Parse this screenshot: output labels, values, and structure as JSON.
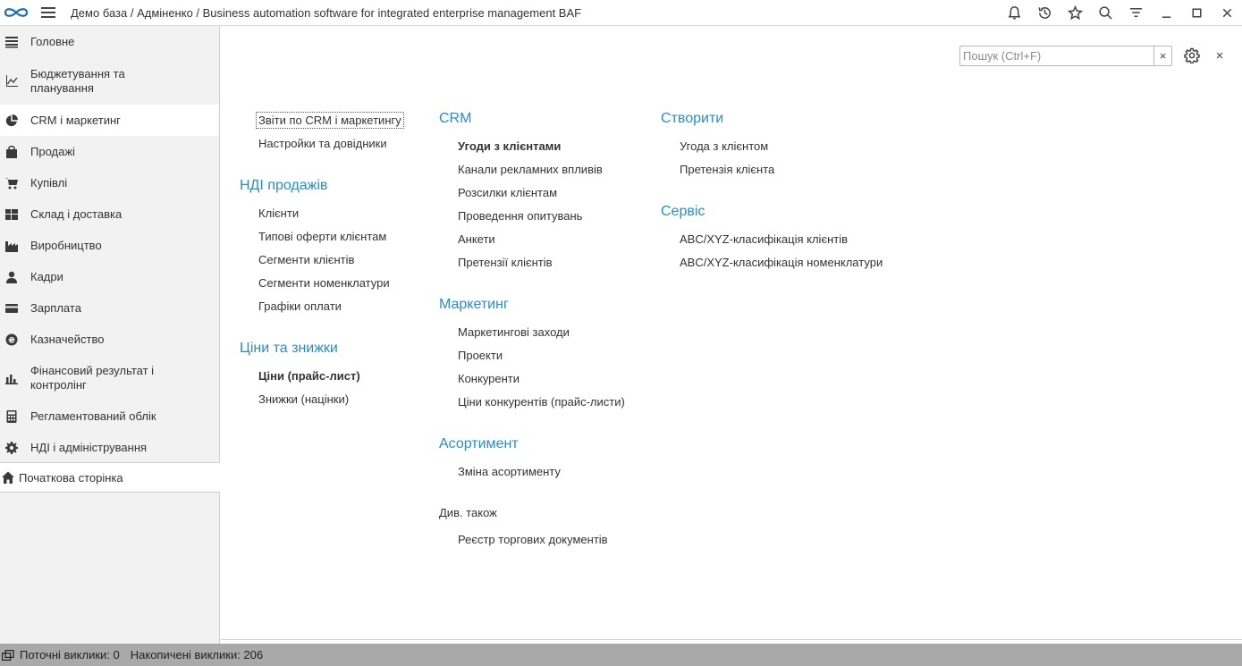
{
  "window": {
    "title": "Демо база / Адміненко / Business automation software for integrated enterprise management BAF"
  },
  "toolbar_icons": [
    "bell-icon",
    "history-icon",
    "star-icon",
    "search-icon",
    "filter-icon",
    "minimize-icon",
    "maximize-icon",
    "close-icon"
  ],
  "sidebar": {
    "items": [
      {
        "label": "Головне",
        "icon": "list-icon"
      },
      {
        "label": "Бюджетування та планування",
        "icon": "chart-line-icon"
      },
      {
        "label": "CRM і маркетинг",
        "icon": "pie-chart-icon"
      },
      {
        "label": "Продажі",
        "icon": "bag-icon"
      },
      {
        "label": "Купівлі",
        "icon": "cart-icon"
      },
      {
        "label": "Склад і доставка",
        "icon": "grid-icon"
      },
      {
        "label": "Виробництво",
        "icon": "factory-icon"
      },
      {
        "label": "Кадри",
        "icon": "person-icon"
      },
      {
        "label": "Зарплата",
        "icon": "card-icon"
      },
      {
        "label": "Казначейство",
        "icon": "coin-icon"
      },
      {
        "label": "Фінансовий результат і контролінг",
        "icon": "bar-chart-icon"
      },
      {
        "label": "Регламентований облік",
        "icon": "calculator-icon"
      },
      {
        "label": "НДІ і адміністрування",
        "icon": "gear-icon"
      }
    ],
    "home": {
      "label": "Початкова сторінка",
      "icon": "home-icon"
    }
  },
  "main": {
    "search_placeholder": "Пошук (Ctrl+F)",
    "search_clear": "×",
    "close": "×",
    "col1": {
      "top_links": [
        "Звіти по CRM і маркетингу",
        "Настройки та довідники"
      ],
      "groups": [
        {
          "title": "НДІ продажів",
          "links": [
            "Клієнти",
            "Типові оферти клієнтам",
            "Сегменти клієнтів",
            "Сегменти номенклатури",
            "Графіки оплати"
          ]
        },
        {
          "title": "Ціни та знижки",
          "links": [
            "Ціни (прайс-лист)",
            "Знижки (націнки)"
          ]
        }
      ]
    },
    "col2": {
      "groups": [
        {
          "title": "CRM",
          "links": [
            "Угоди з клієнтами",
            "Канали рекламних впливів",
            "Розсилки клієнтам",
            "Проведення опитувань",
            "Анкети",
            "Претензії клієнтів"
          ]
        },
        {
          "title": "Маркетинг",
          "links": [
            "Маркетингові заходи",
            "Проекти",
            "Конкуренти",
            "Ціни конкурентів (прайс-листи)"
          ]
        },
        {
          "title": "Асортимент",
          "links": [
            "Зміна асортименту"
          ]
        }
      ],
      "see_also": {
        "title": "Див. також",
        "links": [
          "Реєстр торгових документів"
        ]
      }
    },
    "col3": {
      "groups": [
        {
          "title": "Створити",
          "links": [
            "Угода з клієнтом",
            "Претензія клієнта"
          ]
        },
        {
          "title": "Сервіс",
          "links": [
            "ABC/XYZ-класифікація клієнтів",
            "ABC/XYZ-класифікація номенклатури"
          ]
        }
      ]
    }
  },
  "statusbar": {
    "current_calls": "Поточні виклики: 0",
    "accumulated_calls": "Накопичені виклики: 206"
  }
}
